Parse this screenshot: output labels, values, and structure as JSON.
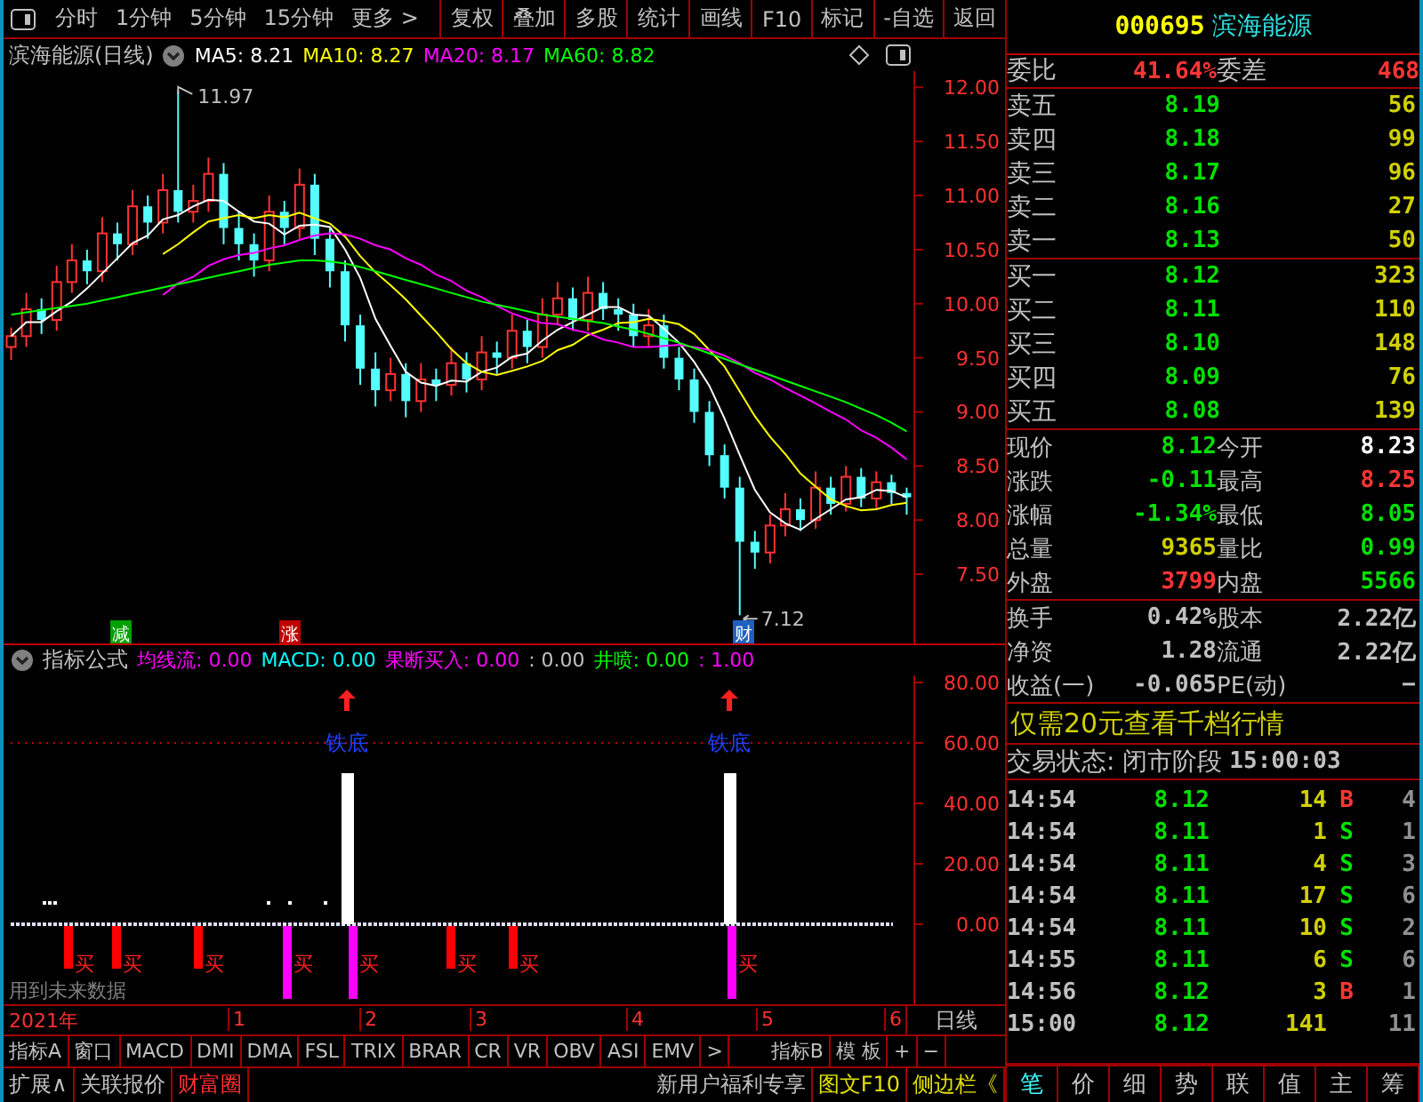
{
  "toolbar": {
    "period_tabs": [
      "分时",
      "1分钟",
      "5分钟",
      "15分钟",
      "更多 >"
    ],
    "buttons": [
      "复权",
      "叠加",
      "多股",
      "统计",
      "画线",
      "F10",
      "标记",
      "-自选",
      "返回"
    ]
  },
  "price_chart": {
    "title": "滨海能源(日线)",
    "ma_values": [
      ": 8.21",
      ": 8.27",
      ": 8.17",
      ": 8.82"
    ],
    "chart_data": {
      "type": "candlestick",
      "ylim": [
        6.86,
        12.15
      ],
      "yticks": [
        {
          "value": 12,
          "label": "12.00"
        },
        {
          "value": 11.5,
          "label": "11.50"
        },
        {
          "value": 11,
          "label": "11.00"
        },
        {
          "value": 10.5,
          "label": "10.50"
        },
        {
          "value": 10,
          "label": "10.00"
        },
        {
          "value": 9.5,
          "label": "9.50"
        },
        {
          "value": 9,
          "label": "9.00"
        },
        {
          "value": 8.5,
          "label": "8.50"
        },
        {
          "value": 8,
          "label": "8.00"
        },
        {
          "value": 7.5,
          "label": "7.50"
        }
      ],
      "categories": [
        null,
        null,
        null,
        null,
        null,
        null,
        null,
        null,
        null,
        null,
        null,
        null,
        null,
        null,
        null,
        null,
        null,
        null,
        null,
        null,
        null,
        null,
        null,
        null,
        null,
        null,
        null,
        null,
        null,
        null,
        null,
        null,
        null,
        null,
        null,
        null,
        null,
        null,
        null,
        null,
        null,
        null,
        null,
        null,
        null,
        null,
        null,
        null,
        null,
        null,
        null,
        null,
        null,
        null,
        null,
        null,
        null,
        null,
        null,
        null
      ],
      "ohlc": [
        [
          9.6,
          9.78,
          9.48,
          9.7
        ],
        [
          9.7,
          10.1,
          9.6,
          9.95
        ],
        [
          9.95,
          10.05,
          9.72,
          9.85
        ],
        [
          9.85,
          10.35,
          9.75,
          10.2
        ],
        [
          10.2,
          10.55,
          10.1,
          10.4
        ],
        [
          10.4,
          10.5,
          10.18,
          10.3
        ],
        [
          10.3,
          10.8,
          10.2,
          10.65
        ],
        [
          10.65,
          10.75,
          10.4,
          10.55
        ],
        [
          10.55,
          11.05,
          10.45,
          10.9
        ],
        [
          10.9,
          11.0,
          10.6,
          10.75
        ],
        [
          10.75,
          11.2,
          10.65,
          11.05
        ],
        [
          11.05,
          11.97,
          10.75,
          10.85
        ],
        [
          10.85,
          11.1,
          10.75,
          10.95
        ],
        [
          10.95,
          11.35,
          10.85,
          11.2
        ],
        [
          11.2,
          11.3,
          10.55,
          10.7
        ],
        [
          10.7,
          10.85,
          10.4,
          10.55
        ],
        [
          10.55,
          10.65,
          10.25,
          10.4
        ],
        [
          10.4,
          11.0,
          10.3,
          10.85
        ],
        [
          10.85,
          10.95,
          10.55,
          10.7
        ],
        [
          10.7,
          11.25,
          10.6,
          11.1
        ],
        [
          11.1,
          11.2,
          10.45,
          10.6
        ],
        [
          10.6,
          10.7,
          10.15,
          10.3
        ],
        [
          10.3,
          10.4,
          9.65,
          9.8
        ],
        [
          9.8,
          9.9,
          9.25,
          9.4
        ],
        [
          9.4,
          9.55,
          9.05,
          9.2
        ],
        [
          9.2,
          9.5,
          9.1,
          9.35
        ],
        [
          9.35,
          9.45,
          8.95,
          9.1
        ],
        [
          9.1,
          9.45,
          9.0,
          9.3
        ],
        [
          9.3,
          9.4,
          9.1,
          9.25
        ],
        [
          9.25,
          9.6,
          9.15,
          9.45
        ],
        [
          9.45,
          9.55,
          9.18,
          9.3
        ],
        [
          9.3,
          9.7,
          9.2,
          9.55
        ],
        [
          9.55,
          9.65,
          9.35,
          9.5
        ],
        [
          9.5,
          9.9,
          9.4,
          9.75
        ],
        [
          9.75,
          9.85,
          9.45,
          9.6
        ],
        [
          9.6,
          10.05,
          9.5,
          9.9
        ],
        [
          9.9,
          10.2,
          9.8,
          10.05
        ],
        [
          10.05,
          10.15,
          9.75,
          9.85
        ],
        [
          9.85,
          10.25,
          9.75,
          10.1
        ],
        [
          10.1,
          10.2,
          9.85,
          9.95
        ],
        [
          9.95,
          10.05,
          9.75,
          9.9
        ],
        [
          9.9,
          10.0,
          9.6,
          9.7
        ],
        [
          9.7,
          9.95,
          9.6,
          9.8
        ],
        [
          9.8,
          9.9,
          9.4,
          9.5
        ],
        [
          9.5,
          9.6,
          9.2,
          9.3
        ],
        [
          9.3,
          9.4,
          8.9,
          9.0
        ],
        [
          9.0,
          9.1,
          8.5,
          8.6
        ],
        [
          8.6,
          8.7,
          8.2,
          8.3
        ],
        [
          8.3,
          8.4,
          7.12,
          7.8
        ],
        [
          7.8,
          7.9,
          7.55,
          7.7
        ],
        [
          7.7,
          8.05,
          7.6,
          7.95
        ],
        [
          7.95,
          8.25,
          7.85,
          8.1
        ],
        [
          8.1,
          8.2,
          7.9,
          8.0
        ],
        [
          8.0,
          8.45,
          7.92,
          8.3
        ],
        [
          8.3,
          8.4,
          8.05,
          8.15
        ],
        [
          8.15,
          8.5,
          8.08,
          8.4
        ],
        [
          8.4,
          8.48,
          8.12,
          8.2
        ],
        [
          8.2,
          8.45,
          8.1,
          8.35
        ],
        [
          8.35,
          8.42,
          8.15,
          8.25
        ],
        [
          8.25,
          8.3,
          8.05,
          8.21
        ]
      ],
      "series": [
        {
          "name": "MA5",
          "type": "line",
          "color": "#ffffff",
          "values": [
            9.7,
            9.83,
            9.83,
            9.93,
            10.02,
            10.14,
            10.28,
            10.42,
            10.56,
            10.63,
            10.78,
            10.82,
            10.9,
            10.96,
            10.95,
            10.85,
            10.76,
            10.74,
            10.64,
            10.72,
            10.73,
            10.71,
            10.5,
            10.24,
            9.86,
            9.61,
            9.37,
            9.27,
            9.24,
            9.29,
            9.28,
            9.37,
            9.41,
            9.51,
            9.54,
            9.66,
            9.76,
            9.83,
            9.9,
            9.97,
            9.97,
            9.9,
            9.89,
            9.77,
            9.64,
            9.46,
            9.24,
            8.94,
            8.6,
            8.28,
            8.07,
            7.97,
            7.91,
            8.01,
            8.1,
            8.19,
            8.21,
            8.28,
            8.27,
            8.21
          ]
        },
        {
          "name": "MA10",
          "type": "line",
          "color": "#ffff00",
          "values": [
            null,
            null,
            null,
            null,
            null,
            null,
            null,
            null,
            null,
            null,
            10.46,
            10.55,
            10.66,
            10.76,
            10.79,
            10.82,
            10.79,
            10.82,
            10.8,
            10.84,
            10.79,
            10.74,
            10.62,
            10.44,
            10.29,
            10.17,
            10.04,
            9.89,
            9.74,
            9.58,
            9.45,
            9.37,
            9.34,
            9.38,
            9.42,
            9.47,
            9.57,
            9.62,
            9.71,
            9.76,
            9.82,
            9.83,
            9.86,
            9.84,
            9.81,
            9.72,
            9.57,
            9.42,
            9.19,
            8.96,
            8.77,
            8.61,
            8.43,
            8.31,
            8.19,
            8.13,
            8.09,
            8.1,
            8.14,
            8.16
          ]
        },
        {
          "name": "MA20",
          "type": "line",
          "color": "#ff00ff",
          "values": [
            null,
            null,
            null,
            null,
            null,
            null,
            null,
            null,
            null,
            null,
            10.08,
            10.19,
            10.25,
            10.35,
            10.41,
            10.45,
            10.47,
            10.51,
            10.54,
            10.59,
            10.63,
            10.65,
            10.64,
            10.6,
            10.54,
            10.5,
            10.42,
            10.36,
            10.27,
            10.21,
            10.12,
            10.06,
            9.98,
            9.91,
            9.86,
            9.82,
            9.81,
            9.76,
            9.73,
            9.67,
            9.64,
            9.6,
            9.6,
            9.61,
            9.62,
            9.6,
            9.57,
            9.52,
            9.45,
            9.36,
            9.3,
            9.22,
            9.15,
            9.08,
            9.0,
            8.93,
            8.83,
            8.76,
            8.67,
            8.56
          ]
        },
        {
          "name": "MA60",
          "type": "line",
          "color": "#00ff00",
          "values": [
            9.9,
            9.92,
            9.94,
            9.96,
            9.98,
            10.0,
            10.03,
            10.06,
            10.09,
            10.12,
            10.15,
            10.18,
            10.21,
            10.24,
            10.27,
            10.3,
            10.33,
            10.36,
            10.38,
            10.4,
            10.4,
            10.39,
            10.37,
            10.34,
            10.3,
            10.26,
            10.22,
            10.18,
            10.14,
            10.1,
            10.06,
            10.02,
            9.99,
            9.96,
            9.93,
            9.9,
            9.88,
            9.86,
            9.84,
            9.82,
            9.79,
            9.76,
            9.72,
            9.68,
            9.64,
            9.59,
            9.54,
            9.49,
            9.44,
            9.39,
            9.34,
            9.29,
            9.24,
            9.19,
            9.14,
            9.09,
            9.03,
            8.97,
            8.9,
            8.82
          ]
        }
      ]
    },
    "high_label": "11.97",
    "low_label": "7.12",
    "markers": [
      {
        "text": "减",
        "color": "#00a000"
      },
      {
        "text": "涨",
        "color": "#c00000"
      },
      {
        "text": "财",
        "color": "#2060c0"
      }
    ]
  },
  "indicator": {
    "title": "指标公式",
    "legend": [
      {
        "label": "均线流: 0.00",
        "color": "#ff00ff"
      },
      {
        "label": "MACD: 0.00",
        "color": "#00ffff"
      },
      {
        "label": "果断买入: 0.00",
        "color": "#ff00ff"
      },
      {
        "label": ": 0.00",
        "color": "#c0c0c0"
      },
      {
        "label": "井喷: 0.00",
        "color": "#00ff00"
      },
      {
        "label": ": 1.00",
        "color": "#ff00ff"
      }
    ],
    "axis_labels": [
      "80.00",
      "60.00",
      "40.00",
      "20.00",
      "0.00"
    ],
    "signal_labels": [
      "铁底",
      "铁底"
    ],
    "buy_labels": [
      "买",
      "买",
      "买",
      "买",
      "买",
      "买",
      "买",
      "买"
    ],
    "note": "用到未来数据"
  },
  "time_axis": {
    "year": "2021年",
    "months": [
      "1",
      "2",
      "3",
      "4",
      "5",
      "6"
    ],
    "period": "日线"
  },
  "indicator_tabs": [
    "指标A",
    "窗口",
    "MACD",
    "DMI",
    "DMA",
    "FSL",
    "TRIX",
    "BRAR",
    "CR",
    "VR",
    "OBV",
    "ASI",
    "EMV",
    ">",
    "指标B",
    "模 板",
    "+",
    "−"
  ],
  "bottom_bar": {
    "left": [
      {
        "label": "扩展∧",
        "kind": "plain"
      },
      {
        "label": "关联报价",
        "kind": "plain"
      },
      {
        "label": "财富圈",
        "kind": "hot"
      }
    ],
    "right": [
      {
        "label": "新用户福利专享",
        "kind": "plain"
      },
      {
        "label": "图文F10",
        "kind": "feature"
      },
      {
        "label": "侧边栏《",
        "kind": "feature"
      }
    ]
  },
  "quote": {
    "code": "000695",
    "name": "滨海能源"
  },
  "order_ratio": {
    "label": "委比",
    "value": "41.64%",
    "diff_label": "委差",
    "diff_value": "468"
  },
  "asks": [
    {
      "label": "卖五",
      "price": "8.19",
      "volume": "56"
    },
    {
      "label": "卖四",
      "price": "8.18",
      "volume": "99"
    },
    {
      "label": "卖三",
      "price": "8.17",
      "volume": "96"
    },
    {
      "label": "卖二",
      "price": "8.16",
      "volume": "27"
    },
    {
      "label": "卖一",
      "price": "8.13",
      "volume": "50"
    }
  ],
  "bids": [
    {
      "label": "买一",
      "price": "8.12",
      "volume": "323"
    },
    {
      "label": "买二",
      "price": "8.11",
      "volume": "110"
    },
    {
      "label": "买三",
      "price": "8.10",
      "volume": "148"
    },
    {
      "label": "买四",
      "price": "8.09",
      "volume": "76"
    },
    {
      "label": "买五",
      "price": "8.08",
      "volume": "139"
    }
  ],
  "stats": [
    [
      {
        "label": "现价",
        "value": "8.12",
        "color": "#00e000"
      },
      {
        "label": "今开",
        "value": "8.23",
        "color": "#ffffff"
      }
    ],
    [
      {
        "label": "涨跌",
        "value": "-0.11",
        "color": "#00e000"
      },
      {
        "label": "最高",
        "value": "8.25",
        "color": "#ff3535"
      }
    ],
    [
      {
        "label": "涨幅",
        "value": "-1.34%",
        "color": "#00e000"
      },
      {
        "label": "最低",
        "value": "8.05",
        "color": "#00e000"
      }
    ],
    [
      {
        "label": "总量",
        "value": "9365",
        "color": "#d0d000"
      },
      {
        "label": "量比",
        "value": "0.99",
        "color": "#00e000"
      }
    ],
    [
      {
        "label": "外盘",
        "value": "3799",
        "color": "#ff3535"
      },
      {
        "label": "内盘",
        "value": "5566",
        "color": "#00e000"
      }
    ]
  ],
  "fundamentals": [
    [
      {
        "label": "换手",
        "value": "0.42%"
      },
      {
        "label": "股本",
        "value": "2.22亿"
      }
    ],
    [
      {
        "label": "净资",
        "value": "1.28"
      },
      {
        "label": "流通",
        "value": "2.22亿"
      }
    ],
    [
      {
        "label": "收益(一)",
        "value": "-0.065"
      },
      {
        "label": "PE(动)",
        "value": "−"
      }
    ]
  ],
  "promo": "仅需20元查看千档行情",
  "trade_status": {
    "label": "交易状态: 闭市阶段",
    "time": "15:00:03"
  },
  "ticks": [
    {
      "time": "14:54",
      "price": "8.12",
      "volume": "14",
      "side": "B",
      "count": "4"
    },
    {
      "time": "14:54",
      "price": "8.11",
      "volume": "1",
      "side": "S",
      "count": "1"
    },
    {
      "time": "14:54",
      "price": "8.11",
      "volume": "4",
      "side": "S",
      "count": "3"
    },
    {
      "time": "14:54",
      "price": "8.11",
      "volume": "17",
      "side": "S",
      "count": "6"
    },
    {
      "time": "14:54",
      "price": "8.11",
      "volume": "10",
      "side": "S",
      "count": "2"
    },
    {
      "time": "14:55",
      "price": "8.11",
      "volume": "6",
      "side": "S",
      "count": "6"
    },
    {
      "time": "14:56",
      "price": "8.12",
      "volume": "3",
      "side": "B",
      "count": "1"
    },
    {
      "time": "15:00",
      "price": "8.12",
      "volume": "141",
      "count": "11"
    }
  ],
  "side_tabs": [
    {
      "label": "笔",
      "selected": true
    },
    {
      "label": "价",
      "selected": false
    },
    {
      "label": "细",
      "selected": false
    },
    {
      "label": "势",
      "selected": false
    },
    {
      "label": "联",
      "selected": false
    },
    {
      "label": "值",
      "selected": false
    },
    {
      "label": "主",
      "selected": false
    },
    {
      "label": "筹",
      "selected": false
    }
  ]
}
